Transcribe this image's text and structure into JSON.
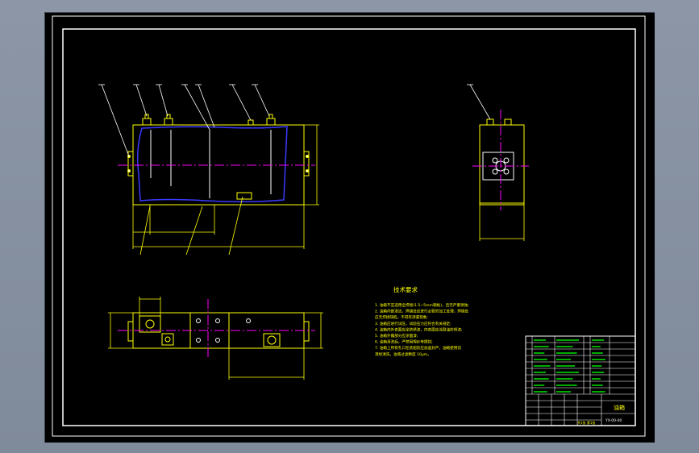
{
  "drawing": {
    "technical_requirements": {
      "title": "技术要求",
      "lines": [
        "1. 油箱不宜选用全焊接(1.5~5mm钢板)，且无严重锈蚀;",
        "2. 油箱内部清洁，焊缝处应进行必要的加工处理，焊缝处",
        "   应无焊接缺陷，不得有渗漏现象;",
        "3. 油箱应进行试压，试验压力应符合有关规定;",
        "4. 油箱内外表面应涂防锈漆，内表面应涂耐油防锈漆;",
        "5. 油箱外露部分应涂面漆;",
        "6. 油箱清洗后，严禁用棉纱等擦拭;",
        "7. 油箱上所有孔口在装配前应加盖封严，油箱使用前",
        "   须经清洗，油液过滤精度 10μm。"
      ]
    },
    "title_block": {
      "name": "油箱",
      "code": "YX-00-00",
      "scale_sheet": "共1张 第1张"
    },
    "colors": {
      "background": "#000000",
      "frame": "#ffffff",
      "geometry": "#ffff00",
      "center_line": "#ff00ff",
      "hidden": "#3a3aff",
      "text": "#ffff00",
      "table_text": "#00ff00"
    }
  }
}
